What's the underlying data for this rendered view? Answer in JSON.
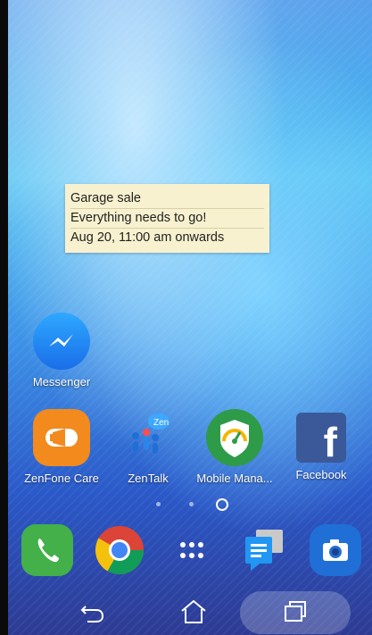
{
  "note": {
    "lines": [
      "Garage sale",
      "Everything needs to go!",
      "Aug 20, 11:00 am onwards"
    ]
  },
  "apps": {
    "messenger": {
      "label": "Messenger",
      "icon": "messenger-icon"
    },
    "zenfone_care": {
      "label": "ZenFone Care",
      "icon": "megaphone-icon"
    },
    "zentalk": {
      "label": "ZenTalk",
      "icon": "zentalk-icon"
    },
    "mobile_manager": {
      "label": "Mobile Mana...",
      "icon": "shield-gauge-icon"
    },
    "facebook": {
      "label": "Facebook",
      "icon": "facebook-icon"
    }
  },
  "dock": {
    "items": [
      {
        "name": "phone",
        "icon": "phone-icon"
      },
      {
        "name": "chrome",
        "icon": "chrome-icon"
      },
      {
        "name": "all-apps",
        "icon": "app-drawer-icon"
      },
      {
        "name": "messages",
        "icon": "messages-icon"
      },
      {
        "name": "camera",
        "icon": "camera-icon"
      }
    ]
  },
  "page_indicator": {
    "pages": 3,
    "current": 3
  },
  "navigation": {
    "back": "back-icon",
    "home": "home-icon",
    "recents": "recents-icon"
  },
  "colors": {
    "note_bg": "#f7f1cf",
    "zenfone_care_orange": "#f28a1e",
    "facebook_blue": "#3b5998",
    "phone_green": "#4caf50",
    "mobile_manager_green": "#2e9b48",
    "camera_blue": "#1f6fd6",
    "messenger_blue": "#1e8cf2"
  }
}
